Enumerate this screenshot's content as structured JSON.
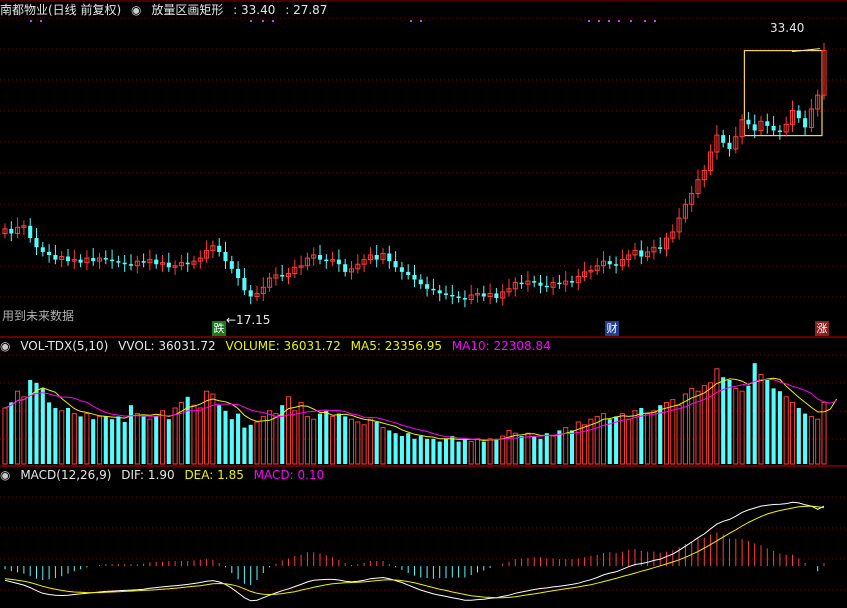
{
  "colors": {
    "background": "#000000",
    "grid": "#7a0000",
    "divider": "#8b0000",
    "up": "#ff3b3b",
    "down": "#54fcfc",
    "white_line": "#ffffff",
    "yellow_line": "#f0f000",
    "magenta_line": "#ff00ff",
    "rect": "#f5d547",
    "dots": "#c040ff"
  },
  "price_header": {
    "stock_title": "南都物业(日线 前复权)",
    "indicator_name": "放量区画矩形",
    "value1": ": 33.40",
    "value2": ": 27.87"
  },
  "volume_header": {
    "name": "VOL-TDX(5,10)",
    "vvol": "VVOL: 36031.72",
    "volume": "VOLUME: 36031.72",
    "ma5": "MA5: 23356.95",
    "ma10": "MA10: 22308.84"
  },
  "macd_header": {
    "name": "MACD(12,26,9)",
    "dif": "DIF: 1.90",
    "dea": "DEA: 1.85",
    "macd": "MACD: 0.10"
  },
  "annotations": {
    "low_label": "←17.15",
    "high_label": "33.40",
    "future_data": "用到未来数据",
    "badge_die": "跌",
    "badge_cai": "财",
    "badge_zhang": "涨"
  },
  "chart_data": [
    {
      "type": "candlestick",
      "pane": "price",
      "ylim": [
        16,
        35
      ],
      "close": [
        21.8,
        21.5,
        21.9,
        22.0,
        21.2,
        20.6,
        20.3,
        20.1,
        19.8,
        20.0,
        19.7,
        19.8,
        19.6,
        19.9,
        19.7,
        19.9,
        19.8,
        19.7,
        19.6,
        19.5,
        19.4,
        19.7,
        19.6,
        19.8,
        19.5,
        19.6,
        19.3,
        19.4,
        19.6,
        19.5,
        19.7,
        19.9,
        20.4,
        20.7,
        20.3,
        19.7,
        19.2,
        18.6,
        17.8,
        17.4,
        17.6,
        18.0,
        18.6,
        18.8,
        18.7,
        18.9,
        19.3,
        19.4,
        19.9,
        20.1,
        19.8,
        19.7,
        19.8,
        19.5,
        19.0,
        19.2,
        19.5,
        19.8,
        20.1,
        19.8,
        20.2,
        19.7,
        19.3,
        19.0,
        18.8,
        18.5,
        18.2,
        17.9,
        17.8,
        17.6,
        17.5,
        17.4,
        17.3,
        17.2,
        17.5,
        17.6,
        17.4,
        17.6,
        17.3,
        17.7,
        17.9,
        18.3,
        18.2,
        18.4,
        18.3,
        18.1,
        18.0,
        18.3,
        18.2,
        18.4,
        18.3,
        18.7,
        19.0,
        19.1,
        19.4,
        19.7,
        19.5,
        19.4,
        19.8,
        20.1,
        20.4,
        20.0,
        20.3,
        20.6,
        20.5,
        21.2,
        21.6,
        22.5,
        23.4,
        24.1,
        25.0,
        25.6,
        26.8,
        27.9,
        27.4,
        27.0,
        27.8,
        28.9,
        28.6,
        28.2,
        28.8,
        28.5,
        28.2,
        28.1,
        28.6,
        29.5,
        29.0,
        28.4,
        29.6,
        30.5,
        33.4
      ],
      "annotations": {
        "low": 17.15,
        "high": 33.4,
        "rect_top": 33.4,
        "rect_bottom": 27.87
      }
    },
    {
      "type": "bar",
      "pane": "volume",
      "series_labels": [
        "VOLUME",
        "MA5",
        "MA10"
      ],
      "ylim": [
        0,
        40000
      ],
      "values": [
        20000,
        22000,
        26000,
        24000,
        30000,
        29000,
        27000,
        22000,
        20000,
        19000,
        20000,
        18000,
        17000,
        18000,
        16000,
        17000,
        17000,
        16000,
        17000,
        15000,
        21000,
        18000,
        17000,
        16000,
        17000,
        19000,
        16000,
        20000,
        22000,
        24000,
        21000,
        20000,
        26000,
        25000,
        21000,
        19000,
        16000,
        18000,
        13000,
        14000,
        15000,
        17000,
        19000,
        18000,
        21000,
        24000,
        19000,
        22000,
        17000,
        16000,
        18000,
        19000,
        17000,
        18000,
        17000,
        16000,
        15000,
        14000,
        16000,
        15000,
        13000,
        12000,
        11000,
        10000,
        11000,
        9000,
        10000,
        9000,
        9000,
        8000,
        9000,
        10000,
        8000,
        9000,
        8000,
        9000,
        8000,
        9000,
        9000,
        10000,
        12000,
        11000,
        10000,
        11000,
        10000,
        9000,
        11000,
        10000,
        12000,
        13000,
        12000,
        15000,
        14000,
        16000,
        17000,
        18000,
        16000,
        17000,
        18000,
        16000,
        19000,
        20000,
        18000,
        19000,
        21000,
        22000,
        23000,
        21000,
        25000,
        27000,
        26000,
        28000,
        29000,
        34000,
        31000,
        30000,
        27000,
        26000,
        28000,
        36000,
        32000,
        30000,
        27000,
        26000,
        24000,
        22000,
        20000,
        18000,
        17000,
        16000,
        22000,
        25000,
        36000
      ]
    },
    {
      "type": "line",
      "pane": "macd",
      "series_labels": [
        "DIF",
        "DEA",
        "MACD"
      ],
      "ylim": [
        -1.2,
        2.6
      ],
      "dif": [
        -0.45,
        -0.5,
        -0.55,
        -0.6,
        -0.68,
        -0.78,
        -0.86,
        -0.9,
        -0.92,
        -0.93,
        -0.92,
        -0.9,
        -0.88,
        -0.86,
        -0.84,
        -0.82,
        -0.8,
        -0.79,
        -0.78,
        -0.77,
        -0.76,
        -0.75,
        -0.73,
        -0.7,
        -0.68,
        -0.66,
        -0.64,
        -0.62,
        -0.6,
        -0.58,
        -0.55,
        -0.52,
        -0.48,
        -0.46,
        -0.5,
        -0.58,
        -0.7,
        -0.85,
        -1.0,
        -1.1,
        -1.08,
        -1.0,
        -0.92,
        -0.85,
        -0.78,
        -0.72,
        -0.65,
        -0.58,
        -0.5,
        -0.45,
        -0.43,
        -0.42,
        -0.42,
        -0.44,
        -0.48,
        -0.5,
        -0.48,
        -0.45,
        -0.4,
        -0.38,
        -0.36,
        -0.4,
        -0.46,
        -0.52,
        -0.6,
        -0.68,
        -0.76,
        -0.82,
        -0.88,
        -0.92,
        -0.96,
        -1.0,
        -1.04,
        -1.08,
        -1.08,
        -1.06,
        -1.05,
        -1.02,
        -1.0,
        -0.96,
        -0.92,
        -0.86,
        -0.82,
        -0.78,
        -0.74,
        -0.71,
        -0.69,
        -0.66,
        -0.64,
        -0.61,
        -0.58,
        -0.54,
        -0.48,
        -0.43,
        -0.36,
        -0.28,
        -0.22,
        -0.18,
        -0.1,
        -0.02,
        0.05,
        0.08,
        0.12,
        0.18,
        0.22,
        0.3,
        0.38,
        0.5,
        0.63,
        0.76,
        0.9,
        1.02,
        1.18,
        1.33,
        1.42,
        1.48,
        1.58,
        1.7,
        1.78,
        1.84,
        1.9,
        1.93,
        1.95,
        1.96,
        1.98,
        2.02,
        2.0,
        1.94,
        1.9,
        1.8,
        1.9
      ],
      "dea": [
        -0.4,
        -0.42,
        -0.45,
        -0.48,
        -0.52,
        -0.58,
        -0.64,
        -0.69,
        -0.73,
        -0.77,
        -0.8,
        -0.82,
        -0.83,
        -0.84,
        -0.84,
        -0.84,
        -0.83,
        -0.82,
        -0.81,
        -0.8,
        -0.79,
        -0.78,
        -0.77,
        -0.76,
        -0.75,
        -0.73,
        -0.72,
        -0.7,
        -0.68,
        -0.66,
        -0.64,
        -0.62,
        -0.59,
        -0.56,
        -0.55,
        -0.56,
        -0.59,
        -0.64,
        -0.72,
        -0.8,
        -0.86,
        -0.89,
        -0.9,
        -0.89,
        -0.87,
        -0.84,
        -0.81,
        -0.76,
        -0.72,
        -0.67,
        -0.63,
        -0.59,
        -0.56,
        -0.54,
        -0.53,
        -0.52,
        -0.51,
        -0.5,
        -0.48,
        -0.46,
        -0.44,
        -0.43,
        -0.44,
        -0.46,
        -0.49,
        -0.53,
        -0.58,
        -0.63,
        -0.68,
        -0.73,
        -0.77,
        -0.82,
        -0.86,
        -0.9,
        -0.94,
        -0.96,
        -0.98,
        -0.99,
        -1.0,
        -1.0,
        -0.99,
        -0.97,
        -0.94,
        -0.91,
        -0.88,
        -0.85,
        -0.81,
        -0.78,
        -0.75,
        -0.72,
        -0.69,
        -0.66,
        -0.62,
        -0.59,
        -0.54,
        -0.49,
        -0.44,
        -0.39,
        -0.33,
        -0.28,
        -0.22,
        -0.16,
        -0.11,
        -0.05,
        0.01,
        0.07,
        0.13,
        0.2,
        0.28,
        0.37,
        0.46,
        0.57,
        0.68,
        0.8,
        0.92,
        1.04,
        1.15,
        1.27,
        1.38,
        1.48,
        1.57,
        1.65,
        1.71,
        1.76,
        1.8,
        1.84,
        1.88,
        1.89,
        1.9,
        1.88,
        1.85
      ]
    }
  ]
}
